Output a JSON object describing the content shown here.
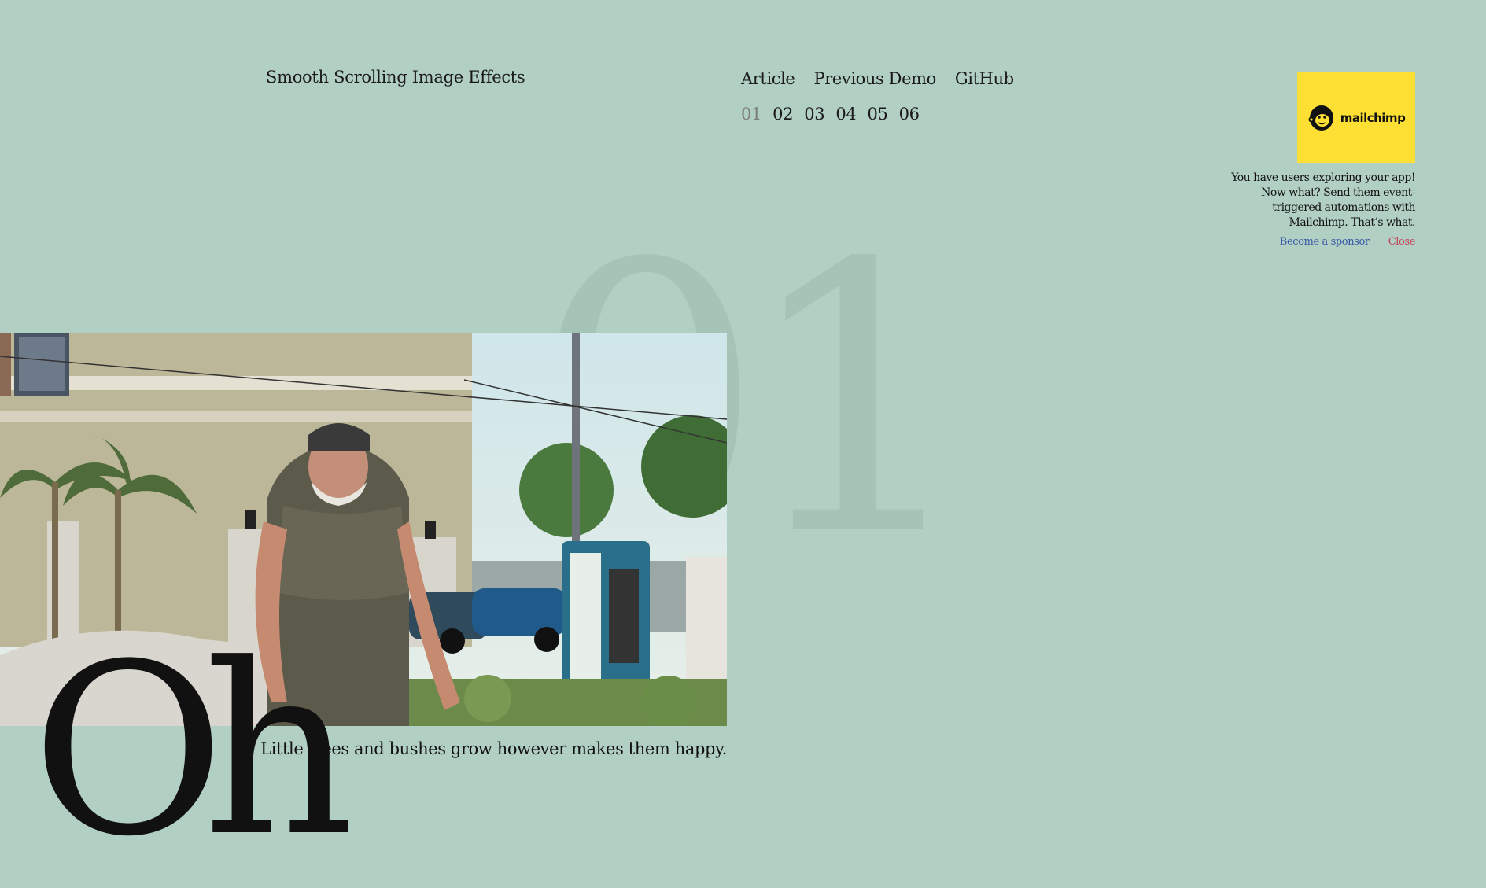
{
  "header": {
    "title": "Smooth Scrolling Image Effects",
    "nav": [
      "Article",
      "Previous Demo",
      "GitHub"
    ],
    "demos": [
      "01",
      "02",
      "03",
      "04",
      "05",
      "06"
    ],
    "current_demo": "01"
  },
  "sponsor": {
    "brand": "mailchimp",
    "logo_bg": "#fde033",
    "text": "You have users exploring your app! Now what? Send them event-triggered automations with Mailchimp. That’s what.",
    "become_label": "Become a sponsor",
    "close_label": "Close"
  },
  "section": {
    "number": "01",
    "word": "Oh",
    "caption": "Little trees and bushes grow however makes them happy."
  },
  "colors": {
    "background": "#b2cfc4",
    "number": "#a6c3b8",
    "accent_line": "#c9914a"
  }
}
